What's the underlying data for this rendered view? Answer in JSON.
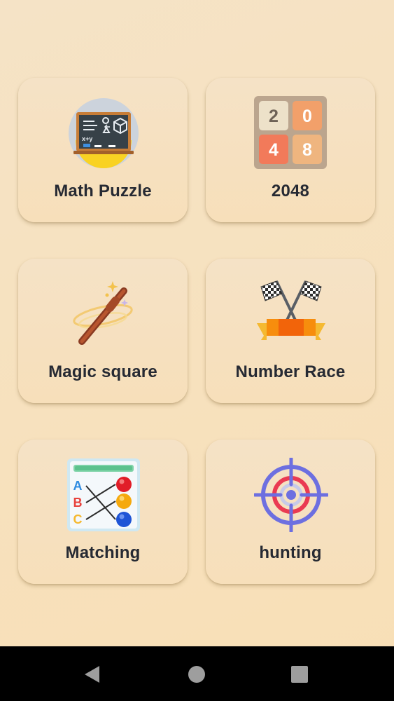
{
  "games": [
    {
      "label": "Math Puzzle",
      "icon": "chalkboard-icon"
    },
    {
      "label": "2048",
      "icon": "tiles-2048-icon"
    },
    {
      "label": "Magic square",
      "icon": "magic-wand-icon"
    },
    {
      "label": "Number Race",
      "icon": "checkered-flags-icon"
    },
    {
      "label": "Matching",
      "icon": "matching-worksheet-icon"
    },
    {
      "label": "hunting",
      "icon": "crosshair-target-icon"
    }
  ],
  "tiles_2048": [
    "2",
    "0",
    "4",
    "8"
  ],
  "math_board": {
    "symbols": "x+y"
  },
  "matching_letters": [
    "A",
    "B",
    "C"
  ],
  "navigation": {
    "back": "back-triangle-icon",
    "home": "home-circle-icon",
    "recents": "recents-square-icon"
  },
  "colors": {
    "background": "#f6e1c2",
    "card": "#f6e0c0",
    "label": "#262a33",
    "nav_bar": "#000000",
    "nav_icons": "#9e9e9e"
  }
}
